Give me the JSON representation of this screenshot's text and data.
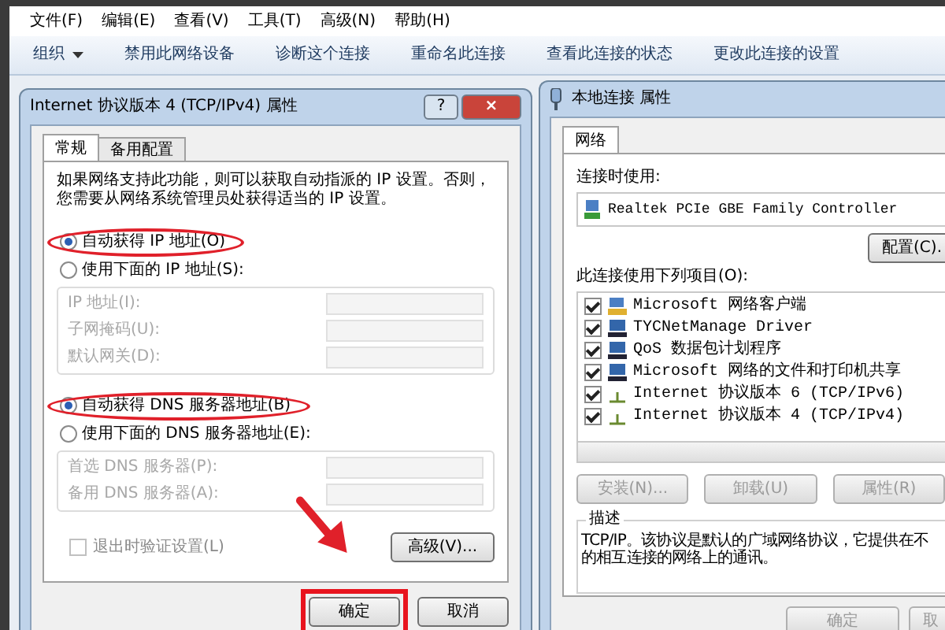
{
  "menu_bar": [
    {
      "label": "文件(F)"
    },
    {
      "label": "编辑(E)"
    },
    {
      "label": "查看(V)"
    },
    {
      "label": "工具(T)"
    },
    {
      "label": "高级(N)"
    },
    {
      "label": "帮助(H)"
    }
  ],
  "toolbar": [
    {
      "label": "组织",
      "kind": "dropdown"
    },
    {
      "label": "禁用此网络设备",
      "kind": "command"
    },
    {
      "label": "诊断这个连接",
      "kind": "command"
    },
    {
      "label": "重命名此连接",
      "kind": "command"
    },
    {
      "label": "查看此连接的状态",
      "kind": "command"
    },
    {
      "label": "更改此连接的设置",
      "kind": "command"
    }
  ],
  "ipv4_dialog": {
    "title": "Internet 协议版本 4 (TCP/IPv4) 属性",
    "help_button": "?",
    "close_button": "×",
    "tabs": [
      {
        "label": "常规",
        "selected": true
      },
      {
        "label": "备用配置",
        "selected": false
      }
    ],
    "description": "如果网络支持此功能，则可以获取自动指派的 IP 设置。否则，您需要从网络系统管理员处获得适当的 IP 设置。",
    "ip_options": [
      {
        "label": "自动获得 IP 地址(O)",
        "selected": true,
        "highlighted": true
      },
      {
        "label": "使用下面的 IP 地址(S):",
        "selected": false,
        "highlighted": false
      }
    ],
    "ip_fields": [
      {
        "label": "IP 地址(I):",
        "disabled": true
      },
      {
        "label": "子网掩码(U):",
        "disabled": true
      },
      {
        "label": "默认网关(D):",
        "disabled": true
      }
    ],
    "dns_options": [
      {
        "label": "自动获得 DNS 服务器地址(B)",
        "selected": true,
        "highlighted": true
      },
      {
        "label": "使用下面的 DNS 服务器地址(E):",
        "selected": false,
        "highlighted": false
      }
    ],
    "dns_fields": [
      {
        "label": "首选 DNS 服务器(P):",
        "disabled": true
      },
      {
        "label": "备用 DNS 服务器(A):",
        "disabled": true
      }
    ],
    "validate_checkbox": {
      "label": "退出时验证设置(L)",
      "checked": false,
      "disabled": true
    },
    "advanced_button": "高级(V)...",
    "buttons": [
      {
        "label": "确定",
        "highlighted": true
      },
      {
        "label": "取消",
        "highlighted": false
      }
    ]
  },
  "lan_dialog": {
    "title": "本地连接 属性",
    "tabs": [
      {
        "label": "网络",
        "selected": true
      }
    ],
    "connect_using_label": "连接时使用:",
    "adapter": "Realtek PCIe GBE Family Controller",
    "configure_button": "配置(C).",
    "items_label": "此连接使用下列项目(O):",
    "items": [
      {
        "label": "Microsoft 网络客户端",
        "checked": true,
        "kind": "client"
      },
      {
        "label": "TYCNetManage Driver",
        "checked": true,
        "kind": "service"
      },
      {
        "label": "QoS 数据包计划程序",
        "checked": true,
        "kind": "service"
      },
      {
        "label": "Microsoft 网络的文件和打印机共享",
        "checked": true,
        "kind": "service"
      },
      {
        "label": "Internet 协议版本 6 (TCP/IPv6)",
        "checked": true,
        "kind": "protocol"
      },
      {
        "label": "Internet 协议版本 4 (TCP/IPv4)",
        "checked": true,
        "kind": "protocol"
      }
    ],
    "action_buttons": [
      {
        "label": "安装(N)...",
        "disabled": true
      },
      {
        "label": "卸载(U)",
        "disabled": true
      },
      {
        "label": "属性(R)",
        "disabled": true
      }
    ],
    "description_title": "描述",
    "description_lines": [
      "TCP/IP。该协议是默认的广域网络协议，它提供在不",
      "的相互连接的网络上的通讯。"
    ],
    "buttons": [
      {
        "label": "确定"
      },
      {
        "label": "取"
      }
    ]
  }
}
